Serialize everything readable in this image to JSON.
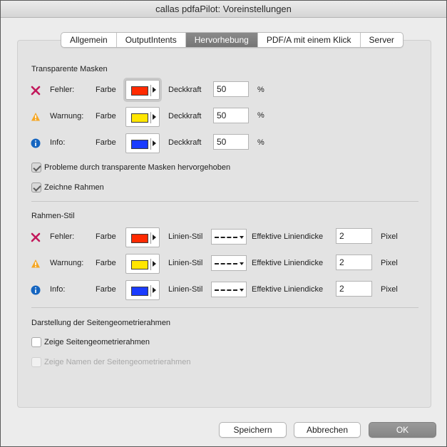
{
  "window": {
    "title": "callas pdfaPilot: Voreinstellungen"
  },
  "tabs": [
    {
      "label": "Allgemein",
      "active": false
    },
    {
      "label": "OutputIntents",
      "active": false
    },
    {
      "label": "Hervorhebung",
      "active": true
    },
    {
      "label": "PDF/A mit einem Klick",
      "active": false
    },
    {
      "label": "Server",
      "active": false
    }
  ],
  "transparent_masks": {
    "title": "Transparente Masken",
    "color_label": "Farbe",
    "opacity_label": "Deckkraft",
    "percent_unit": "%",
    "rows": [
      {
        "icon": "error-x-icon",
        "label": "Fehler:",
        "color": "#ff2a00",
        "opacity": "50"
      },
      {
        "icon": "warning-triangle-icon",
        "label": "Warnung:",
        "color": "#ffe600",
        "opacity": "50"
      },
      {
        "icon": "info-circle-icon",
        "label": "Info:",
        "color": "#1a3bff",
        "opacity": "50"
      }
    ],
    "checkbox_highlight": {
      "label": "Probleme durch transparente Masken hervorgehoben",
      "checked": true
    },
    "checkbox_frame": {
      "label": "Zeichne Rahmen",
      "checked": true
    }
  },
  "frame_style": {
    "title": "Rahmen-Stil",
    "color_label": "Farbe",
    "line_style_label": "Linien-Stil",
    "thickness_label": "Effektive Liniendicke",
    "unit_label": "Pixel",
    "rows": [
      {
        "icon": "error-x-icon",
        "label": "Fehler:",
        "color": "#ff2a00",
        "thickness": "2"
      },
      {
        "icon": "warning-triangle-icon",
        "label": "Warnung:",
        "color": "#ffe600",
        "thickness": "2"
      },
      {
        "icon": "info-circle-icon",
        "label": "Info:",
        "color": "#1a3bff",
        "thickness": "2"
      }
    ]
  },
  "page_geometry": {
    "title": "Darstellung der Seitengeometrierahmen",
    "checkbox_show": {
      "label": "Zeige Seitengeometrierahmen",
      "checked": false
    },
    "checkbox_names": {
      "label": "Zeige Namen der Seitengeometrierahmen",
      "checked": false,
      "disabled": true
    }
  },
  "buttons": {
    "save": "Speichern",
    "cancel": "Abbrechen",
    "ok": "OK"
  },
  "colors": {
    "error_icon": "#c2185b",
    "warning_icon": "#f5a623",
    "info_icon": "#1565c0"
  }
}
